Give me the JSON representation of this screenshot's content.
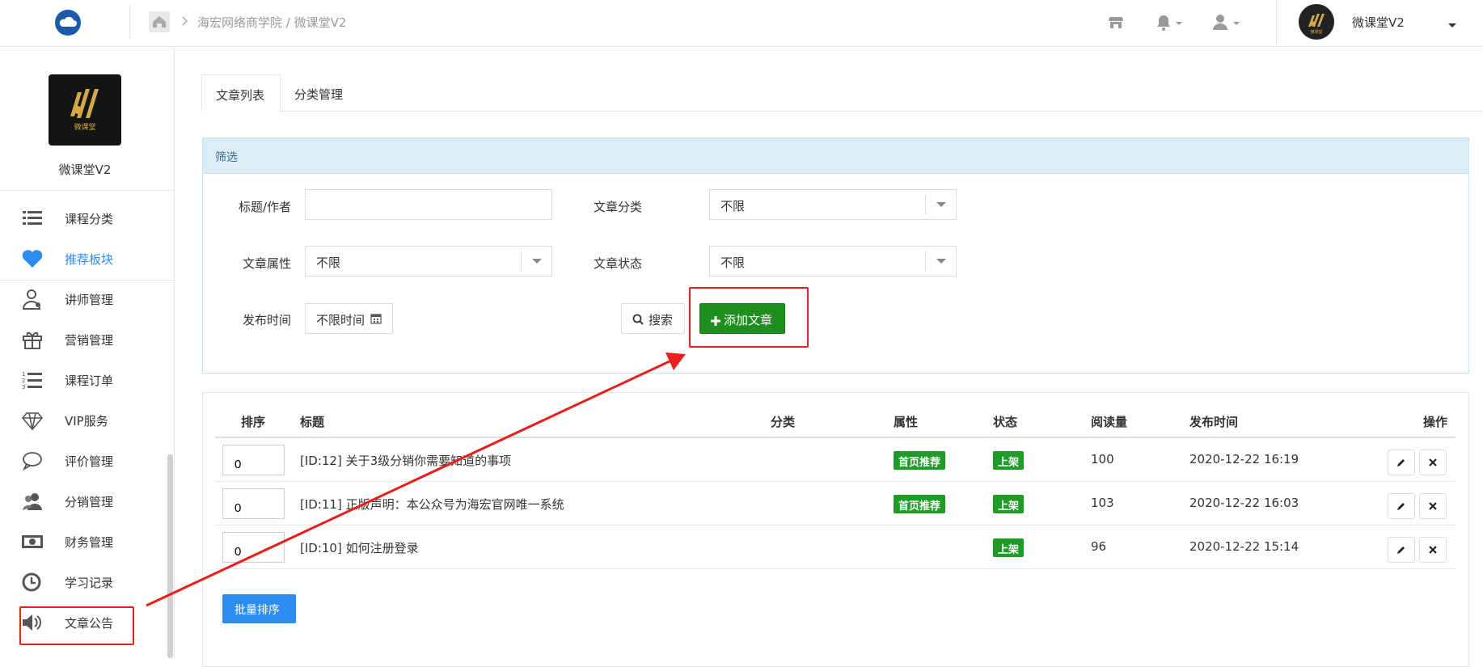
{
  "topbar": {
    "breadcrumb": "海宏网络商学院 / 微课堂V2",
    "account_name": "微课堂V2",
    "brand_logo_text": "微课堂"
  },
  "sidebar": {
    "app_name": "微课堂V2",
    "logo_caption": "微课堂",
    "items": [
      {
        "label": "课程分类",
        "icon": "list-icon",
        "active": false
      },
      {
        "label": "推荐板块",
        "icon": "heart-icon",
        "active": true
      },
      {
        "label": "讲师管理",
        "icon": "teacher-icon",
        "active": false
      },
      {
        "label": "营销管理",
        "icon": "gift-icon",
        "active": false
      },
      {
        "label": "课程订单",
        "icon": "ordered-list-icon",
        "active": false
      },
      {
        "label": "VIP服务",
        "icon": "diamond-icon",
        "active": false
      },
      {
        "label": "评价管理",
        "icon": "comment-icon",
        "active": false
      },
      {
        "label": "分销管理",
        "icon": "users-icon",
        "active": false
      },
      {
        "label": "财务管理",
        "icon": "money-icon",
        "active": false
      },
      {
        "label": "学习记录",
        "icon": "clock-icon",
        "active": false
      },
      {
        "label": "文章公告",
        "icon": "speaker-icon",
        "active": false
      }
    ]
  },
  "tabs": [
    {
      "label": "文章列表",
      "active": true
    },
    {
      "label": "分类管理",
      "active": false
    }
  ],
  "filter": {
    "title": "筛选",
    "title_author_label": "标题/作者",
    "title_author_value": "",
    "category_label": "文章分类",
    "category_value": "不限",
    "attribute_label": "文章属性",
    "attribute_value": "不限",
    "status_label": "文章状态",
    "status_value": "不限",
    "publish_time_label": "发布时间",
    "publish_time_value": "不限时间",
    "search_button": "搜索",
    "add_button": "添加文章"
  },
  "table": {
    "columns": [
      "排序",
      "标题",
      "分类",
      "属性",
      "状态",
      "阅读量",
      "发布时间",
      "操作"
    ],
    "rows": [
      {
        "sort": "0",
        "title": "[ID:12] 关于3级分销你需要知道的事项",
        "category": "",
        "attribute": "首页推荐",
        "status": "上架",
        "reads": "100",
        "time": "2020-12-22 16:19"
      },
      {
        "sort": "0",
        "title": "[ID:11] 正版声明：本公众号为海宏官网唯一系统",
        "category": "",
        "attribute": "首页推荐",
        "status": "上架",
        "reads": "103",
        "time": "2020-12-22 16:03"
      },
      {
        "sort": "0",
        "title": "[ID:10] 如何注册登录",
        "category": "",
        "attribute": "",
        "status": "上架",
        "reads": "96",
        "time": "2020-12-22 15:14"
      }
    ],
    "batch_sort_button": "批量排序"
  },
  "colors": {
    "accent": "#2d8cf0",
    "green": "#1f9a1f",
    "add_green": "#1e8e1e",
    "tag_green": "#1e9c27",
    "annotation_red": "#e8201c",
    "filter_header_bg": "#dcedf7"
  }
}
